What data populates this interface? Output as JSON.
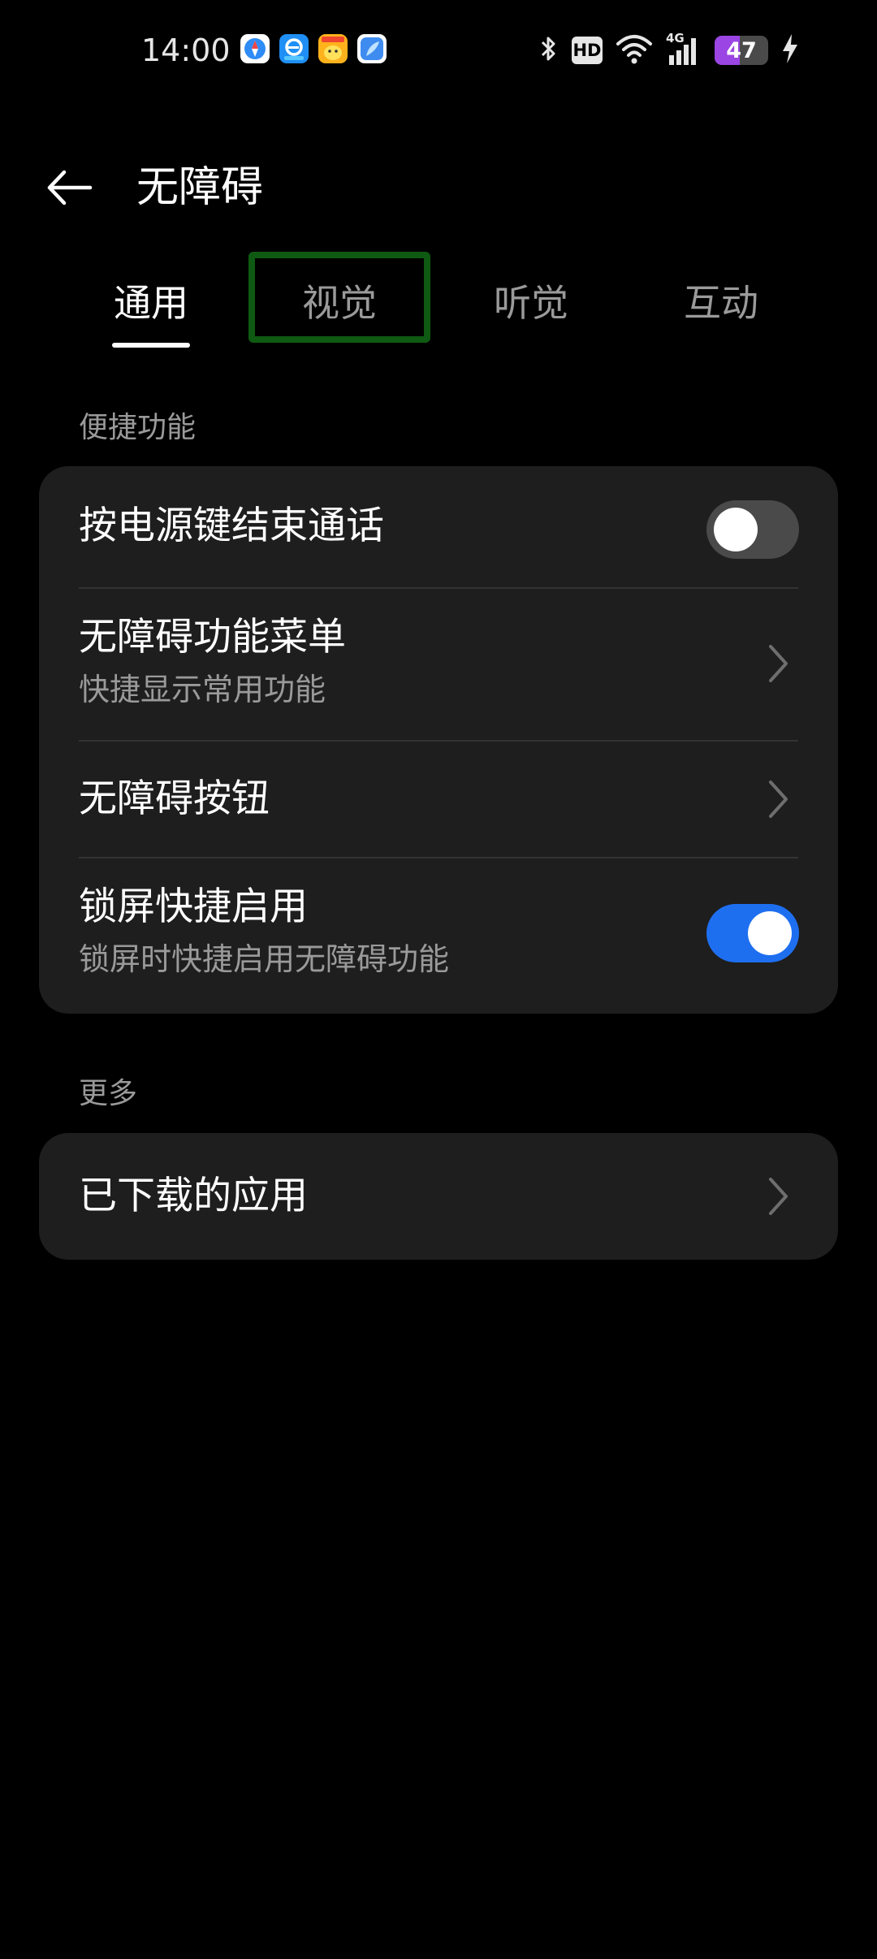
{
  "status_bar": {
    "time": "14:00",
    "notification_icons": [
      "compass-app-icon",
      "browser-app-icon",
      "game-app-icon",
      "feather-app-icon"
    ],
    "network_label": "4G",
    "hd_label": "HD",
    "battery_level": 47,
    "battery_text": "47",
    "charging": true
  },
  "header": {
    "back_icon": "back-arrow-icon",
    "title": "无障碍"
  },
  "tabs": [
    {
      "label": "通用",
      "active": true
    },
    {
      "label": "视觉",
      "active": false
    },
    {
      "label": "听觉",
      "active": false
    },
    {
      "label": "互动",
      "active": false
    }
  ],
  "sections": {
    "shortcuts": {
      "label": "便捷功能",
      "items": [
        {
          "title": "按电源键结束通话",
          "control": "toggle",
          "enabled": false
        },
        {
          "title": "无障碍功能菜单",
          "subtitle": "快捷显示常用功能",
          "control": "chevron"
        },
        {
          "title": "无障碍按钮",
          "control": "chevron"
        },
        {
          "title": "锁屏快捷启用",
          "subtitle": "锁屏时快捷启用无障碍功能",
          "control": "toggle",
          "enabled": true
        }
      ]
    },
    "more": {
      "label": "更多",
      "items": [
        {
          "title": "已下载的应用",
          "control": "chevron"
        }
      ]
    }
  },
  "colors": {
    "background": "#000000",
    "card": "#1e1e1e",
    "accent": "#1e6ff0",
    "battery": "#9b45e4",
    "highlight": "#0e5a12"
  }
}
